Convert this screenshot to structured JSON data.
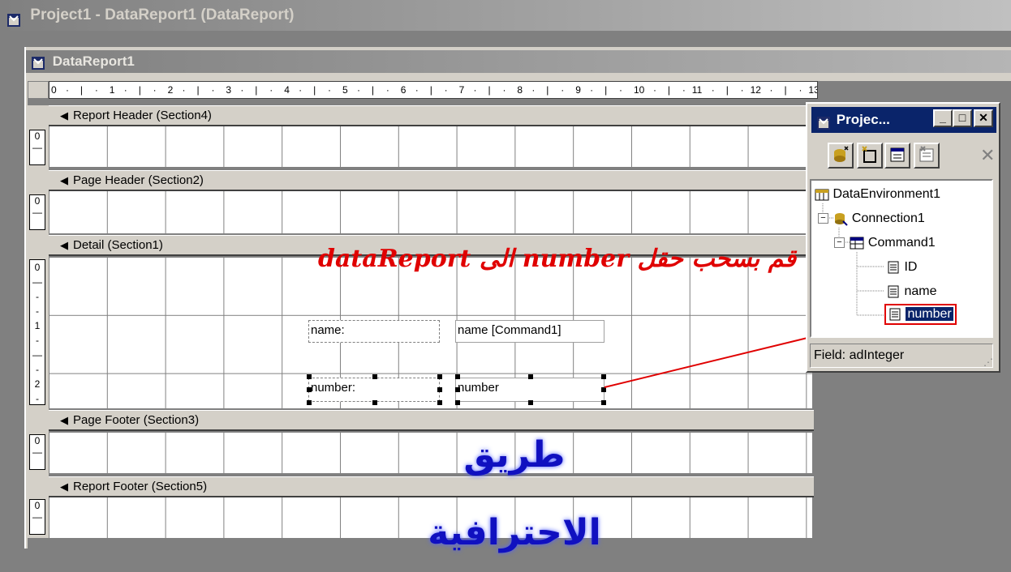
{
  "app": {
    "title": "Project1 - DataReport1 (DataReport)",
    "icon": "vb-window-icon"
  },
  "report_window": {
    "title": "DataReport1",
    "icon": "datareport-icon"
  },
  "ruler": {
    "labels": [
      "0",
      "1",
      "2",
      "3",
      "4",
      "5",
      "6",
      "7",
      "8",
      "9",
      "10",
      "11",
      "12",
      "13"
    ]
  },
  "sections": [
    {
      "label": "Report Header (Section4)",
      "vruler": [
        "0"
      ]
    },
    {
      "label": "Page Header (Section2)",
      "vruler": [
        "0"
      ]
    },
    {
      "label": "Detail (Section1)",
      "vruler": [
        "0",
        "1",
        "2"
      ]
    },
    {
      "label": "Page Footer (Section3)",
      "vruler": [
        "0"
      ]
    },
    {
      "label": "Report Footer (Section5)",
      "vruler": [
        "0"
      ]
    }
  ],
  "detail": {
    "label_name": "name:",
    "textbox_name": "name [Command1]",
    "label_number": "number:",
    "textbox_number": "number"
  },
  "annotation": {
    "caption": "قم بسحب حقل number الى dataReport",
    "arrow_color": "#e00000"
  },
  "watermark": {
    "text": "طريق الاحترافية"
  },
  "project_window": {
    "title": "Projec...",
    "buttons": {
      "minimize": "_",
      "maximize": "□",
      "close": "✕"
    },
    "toolbar_icons": [
      "add-data-environment-icon",
      "insert-connection-icon",
      "add-command-icon",
      "insert-stored-procedure-icon",
      "delete-icon"
    ],
    "tree": {
      "root": "DataEnvironment1",
      "connection": "Connection1",
      "command": "Command1",
      "fields": [
        "ID",
        "name",
        "number"
      ],
      "selected_field": "number"
    },
    "status": "Field: adInteger"
  },
  "colors": {
    "selection": "#0a246a",
    "caption_red": "#e00000",
    "watermark_blue": "#1010c0"
  }
}
